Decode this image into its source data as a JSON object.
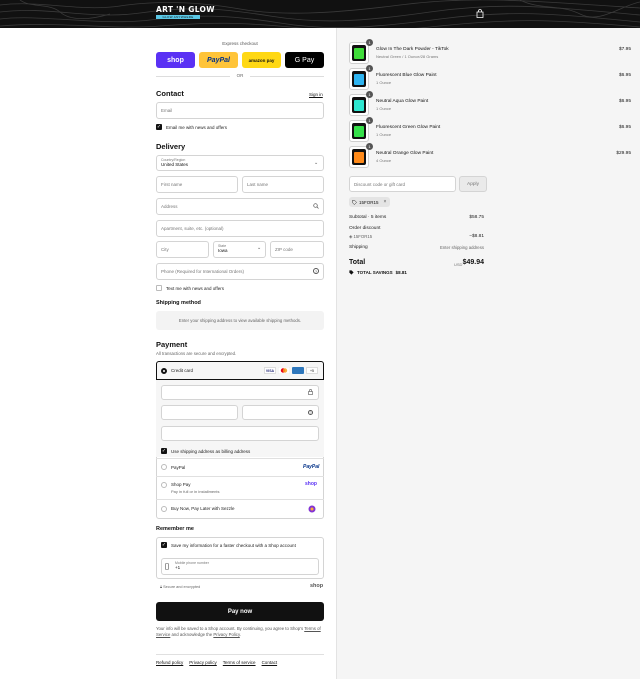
{
  "header": {
    "brand_line1": "ART 'N GLOW",
    "brand_line2": "GLOW ANYWHERE",
    "cart_icon": "bag-icon"
  },
  "express": {
    "title": "Express checkout",
    "shop": "shop",
    "paypal": "PayPal",
    "amazon": "amazon pay",
    "gpay": "G Pay",
    "or": "OR"
  },
  "contact": {
    "heading": "Contact",
    "signin": "Sign in",
    "email_placeholder": "Email",
    "news_label": "Email me with news and offers"
  },
  "delivery": {
    "heading": "Delivery",
    "country_label": "Country/Region",
    "country_value": "United States",
    "first_name": "First name",
    "last_name": "Last name",
    "address": "Address",
    "apartment": "Apartment, suite, etc. (optional)",
    "city": "City",
    "state_label": "State",
    "state_value": "Iowa",
    "zip": "ZIP code",
    "phone": "Phone (Required for International Orders)",
    "text_label": "Text me with news and offers"
  },
  "shipping": {
    "heading": "Shipping method",
    "info": "Enter your shipping address to view available shipping methods."
  },
  "payment": {
    "heading": "Payment",
    "subtitle": "All transactions are secure and encrypted.",
    "credit_card": "Credit card",
    "card_visa": "VISA",
    "card_more": "+5",
    "billing_label": "Use shipping address as billing address",
    "paypal": "PayPal",
    "paypal_logo": "PayPal",
    "shoppay": "Shop Pay",
    "shoppay_sub": "Pay in full or in installments",
    "shoppay_logo": "shop",
    "sezzle": "Buy Now, Pay Later with Sezzle"
  },
  "remember": {
    "heading": "Remember me",
    "save_label": "Save my information for a faster checkout with a Shop account",
    "phone_label": "Mobile phone number",
    "phone_value": "+1",
    "secure": "Secure and encrypted",
    "shop_logo": "shop"
  },
  "pay_button": "Pay now",
  "terms": {
    "line1": "Your info will be saved to a Shop account. By continuing, you agree to Shop's",
    "tos": "Terms of Service",
    "and": "and acknowledge the",
    "privacy": "Privacy Policy",
    "end": "."
  },
  "footer": [
    "Refund policy",
    "Privacy policy",
    "Terms of service",
    "Contact"
  ],
  "cart": {
    "items": [
      {
        "qty": "1",
        "name": "Glow In The Dark Powder - TikTok",
        "variant": "Neutral Green / 1 Ounce/28 Grams",
        "price": "$7.95",
        "color": "#3fdc3a"
      },
      {
        "qty": "1",
        "name": "Fluorescent Blue Glow Paint",
        "variant": "1 Ounce",
        "price": "$6.95",
        "color": "#2fb4f0"
      },
      {
        "qty": "1",
        "name": "Neutral Aqua Glow Paint",
        "variant": "1 Ounce",
        "price": "$6.95",
        "color": "#2ee6d0"
      },
      {
        "qty": "1",
        "name": "Fluorescent Green Glow Paint",
        "variant": "1 Ounce",
        "price": "$6.95",
        "color": "#35e04a"
      },
      {
        "qty": "1",
        "name": "Neutral Orange Glow Paint",
        "variant": "4 Ounce",
        "price": "$29.95",
        "color": "#ff8a1a"
      }
    ],
    "discount_placeholder": "Discount code or gift card",
    "apply": "Apply",
    "code": "15FOR15",
    "subtotal_label": "Subtotal · 5 items",
    "subtotal": "$58.75",
    "order_discount": "Order discount",
    "discount_code": "15FOR15",
    "discount_value": "−$8.81",
    "shipping_label": "Shipping",
    "shipping_value": "Enter shipping address",
    "total_label": "Total",
    "currency": "USD",
    "total": "$49.94",
    "savings_label": "TOTAL SAVINGS",
    "savings": "$8.81"
  }
}
